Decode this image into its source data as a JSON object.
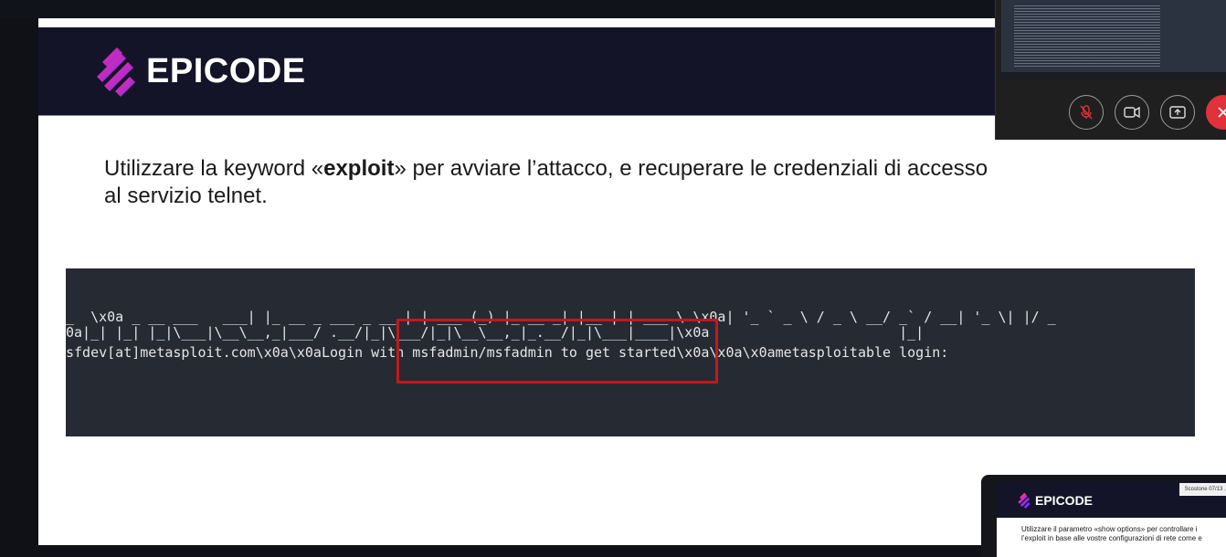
{
  "slide": {
    "logo_text": "EPICODE",
    "instruction": {
      "before": "Utilizzare la keyword «",
      "keyword": "exploit",
      "after": "» per avviare l’attacco, e recuperare le credenziali di accesso",
      "line2": "al servizio telnet."
    },
    "terminal": {
      "lines": [
        "_  \\x0a _ __ ___   ___| |_ __ _ ___ _ __ | | ___ (_) |_ __ _| |__ | | ___ \\ \\x0a| '_ ` _ \\ / _ \\ __/ _` / __| '_ \\| |/ _",
        "0a|_| |_| |_|\\___|\\__\\__,_|___/ .__/|_|\\___/|_|\\__\\__,_|_.__/|_|\\___|____|\\x0a                       |_|",
        "sfdev[at]metasploit.com\\x0a\\x0aLogin with msfadmin/msfadmin to get started\\x0a\\x0a\\x0ametasploitable login:"
      ]
    }
  },
  "call_overlay": {
    "buttons": [
      "mic-muted",
      "camera",
      "share-screen",
      "end-call"
    ]
  },
  "next_slide_thumb": {
    "logo_text": "EPICODE",
    "badge": "Scostone 07/13 ...",
    "line1": "Utilizzare il parametro «show options» per controllare i",
    "line2": "l’exploit in base alle vostre configurazioni di rete come e"
  },
  "colors": {
    "header_bg": "#141428",
    "terminal_bg": "#262a33",
    "highlight_border": "#c4171d",
    "logo_gradient": [
      "#ff2d8a",
      "#7b2cff"
    ],
    "end_call": "#e0323a"
  }
}
